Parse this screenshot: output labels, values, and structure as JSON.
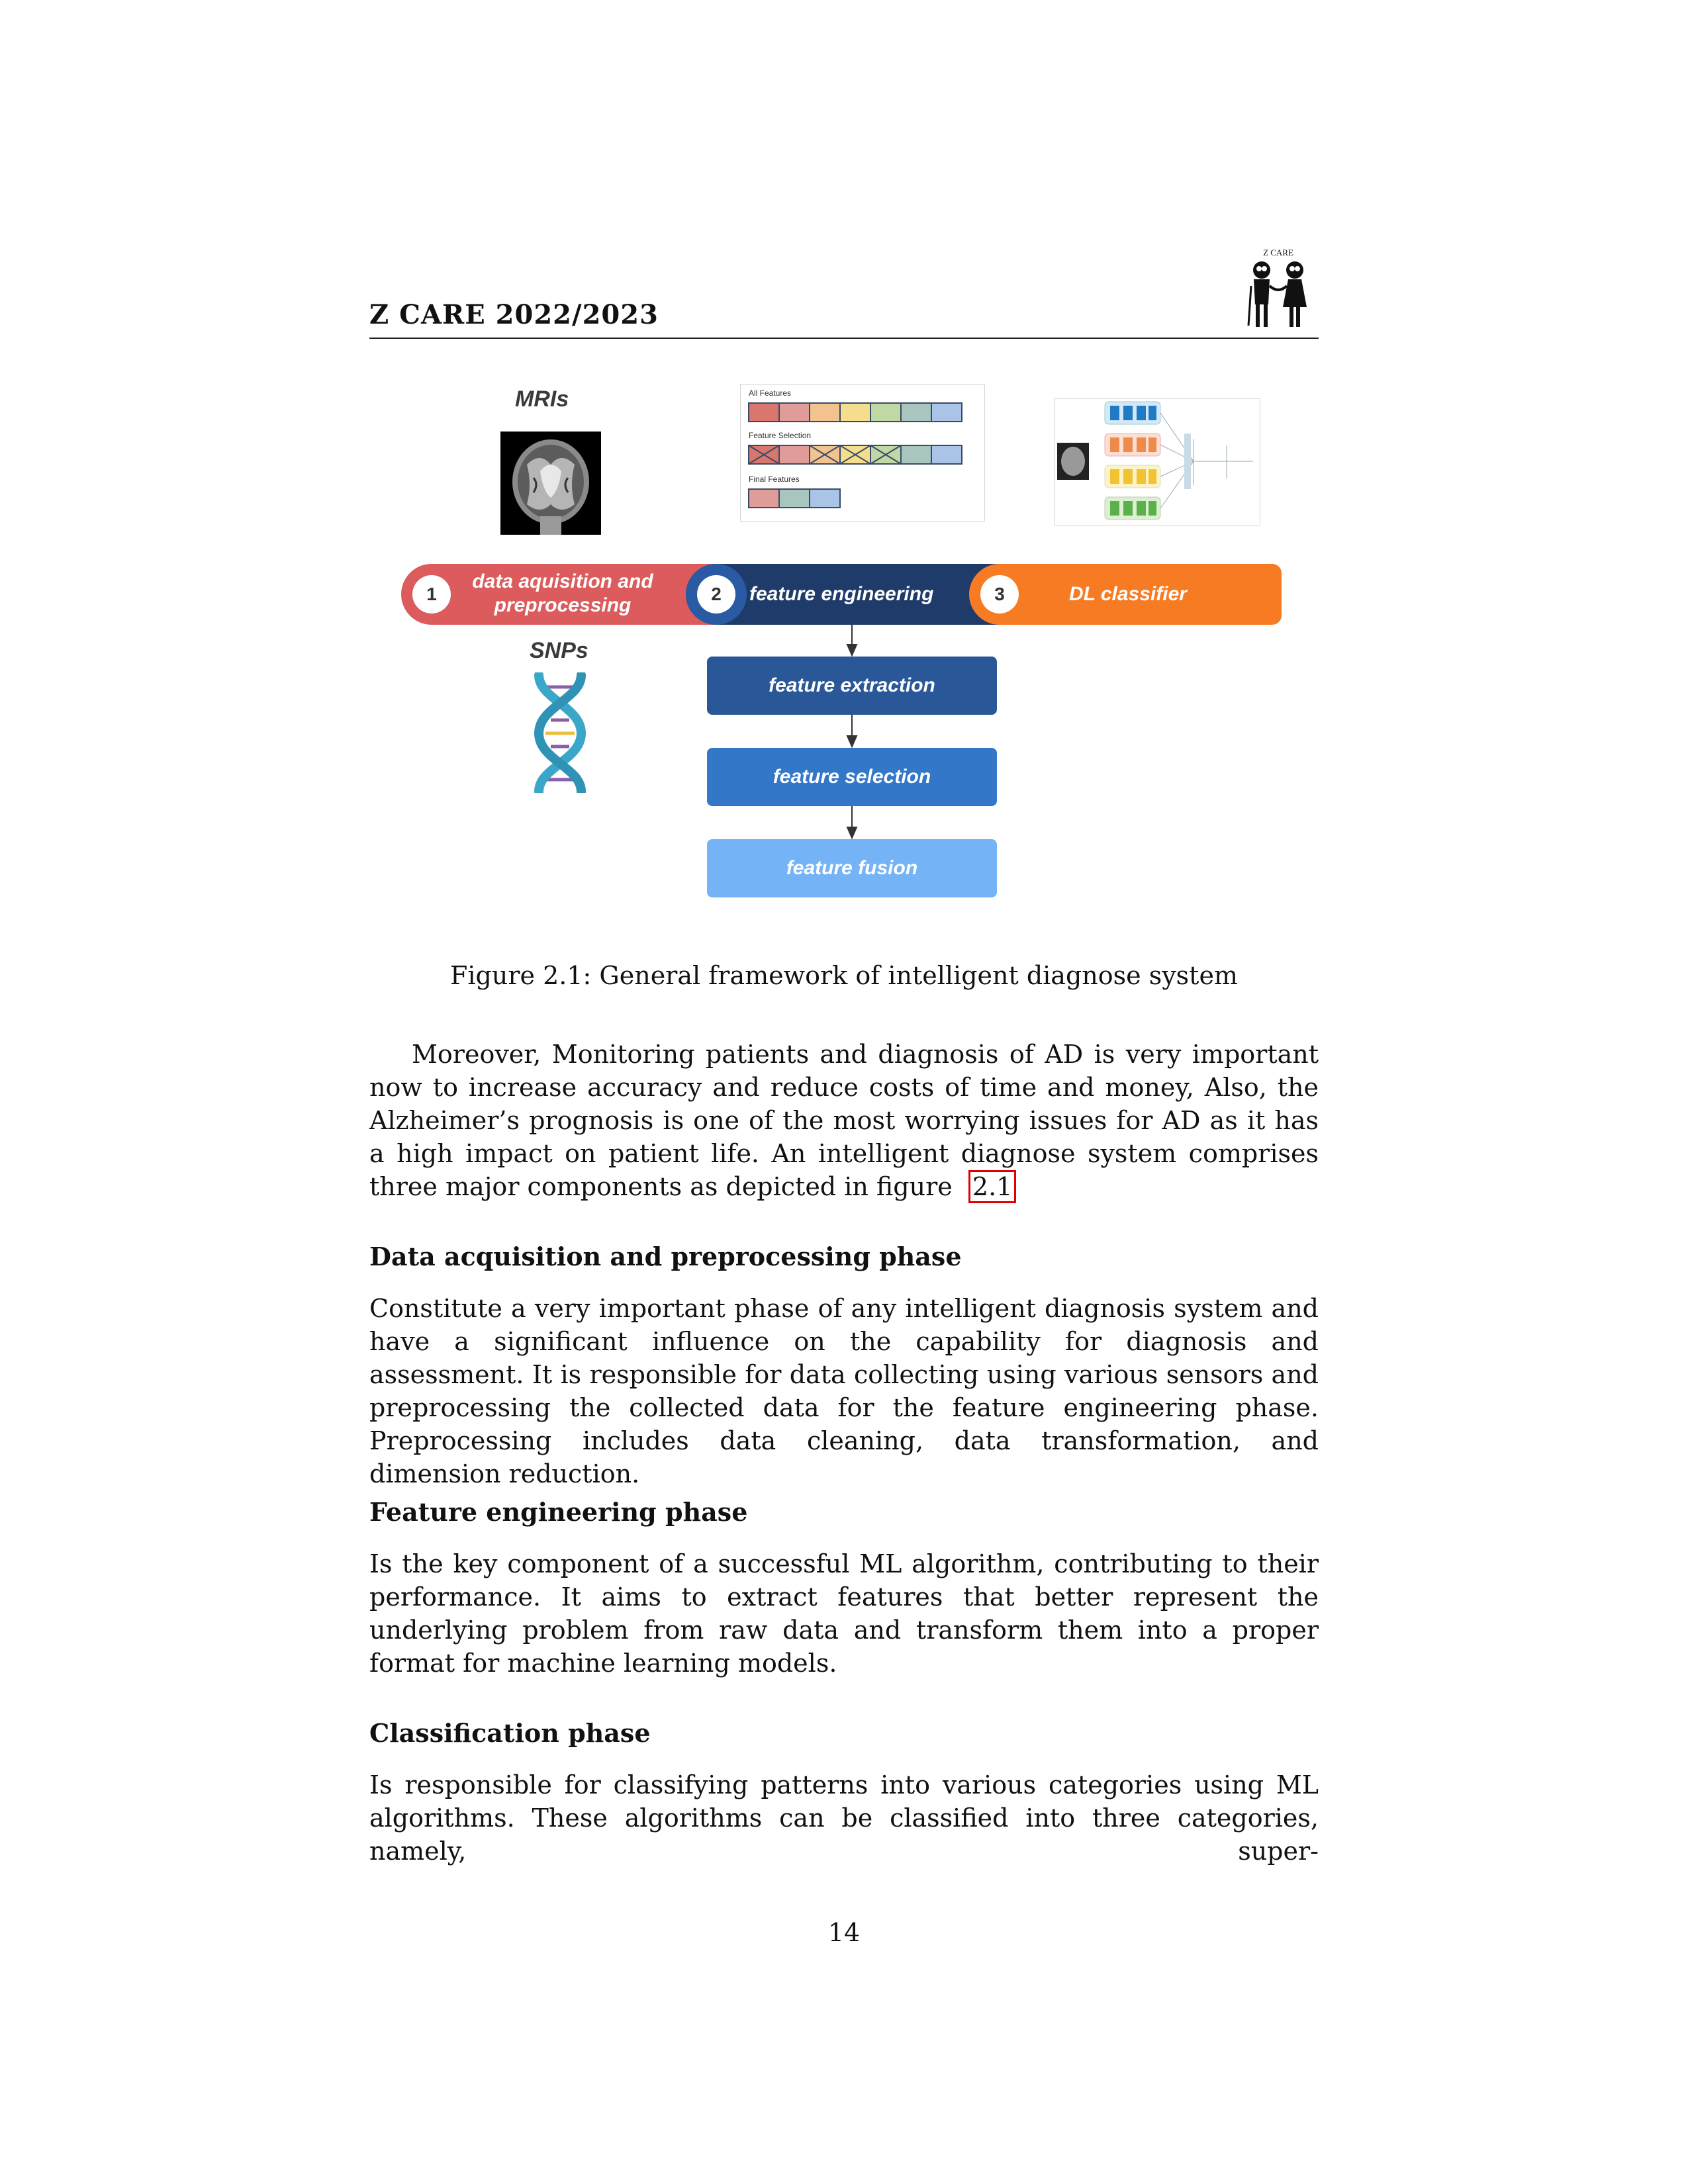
{
  "header": {
    "title": "Z CARE 2022/2023",
    "logo_text": "Z CARE"
  },
  "figure": {
    "mris_label": "MRIs",
    "snps_label": "SNPs",
    "features_panel": {
      "all_features": "All Features",
      "feature_selection": "Feature Selection",
      "final_features": "Final Features"
    },
    "pipeline": [
      {
        "number": "1",
        "label_line1": "data aquisition and",
        "label_line2": "preprocessing",
        "color": "#dc5c5e"
      },
      {
        "number": "2",
        "label_line1": "feature engineering",
        "color": "#1e3b6a"
      },
      {
        "number": "3",
        "label_line1": "DL classifier",
        "color": "#f77b22"
      }
    ],
    "steps": [
      "feature extraction",
      "feature selection",
      "feature fusion"
    ],
    "caption": "Figure 2.1: General framework of intelligent diagnose system"
  },
  "body": {
    "intro": "Moreover, Monitoring patients and diagnosis of AD is very important now to increase accuracy and reduce costs of time and money, Also, the Alzheimer’s prognosis is one of the most worrying issues for AD as it has a high impact on patient life. An intelligent diagnose system comprises three major components as depicted in figure",
    "intro_ref": "2.1",
    "sections": [
      {
        "heading": "Data acquisition and preprocessing phase",
        "text": "Constitute a very important phase of any intelligent diagnosis system and have a significant influence on the capability for diagnosis and assessment. It is responsible for data collecting using various sensors and preprocessing the collected data for the feature engineering phase. Preprocessing includes data cleaning, data transformation, and dimension reduction."
      },
      {
        "heading": "Feature engineering phase",
        "text": "Is the key component of a successful ML algorithm, contributing to their performance. It aims to extract features that better represent the underlying problem from raw data and transform them into a proper format for machine learning models."
      },
      {
        "heading": "Classification phase",
        "text": "Is responsible for classifying patterns into various categories using ML algorithms. These algorithms can be classified into three categories, namely, super-"
      }
    ]
  },
  "page_number": "14"
}
